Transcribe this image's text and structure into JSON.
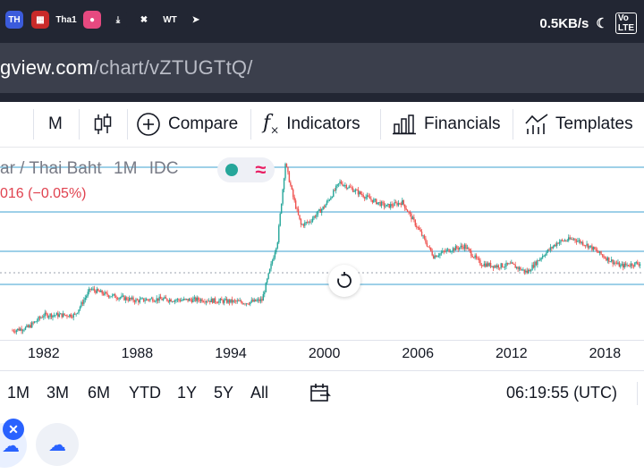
{
  "status_bar": {
    "app_icons": [
      {
        "name": "app-icon-th",
        "text": "TH",
        "color": "#3b5bdb"
      },
      {
        "name": "app-icon-grid",
        "text": "▦",
        "color": "#c92a2a"
      },
      {
        "name": "app-icon-thai",
        "text": "Tha1",
        "color": "#222633"
      },
      {
        "name": "app-icon-pink",
        "text": "●",
        "color": "#e64980"
      },
      {
        "name": "download-icon",
        "text": "⤓",
        "color": "#222633"
      },
      {
        "name": "blocked-icon",
        "text": "✖",
        "color": "#222633"
      },
      {
        "name": "webtoon-icon",
        "text": "WT",
        "color": "#222633"
      },
      {
        "name": "telegram-icon",
        "text": "➤",
        "color": "#222633"
      }
    ],
    "network_speed": "0.5KB/s"
  },
  "url_bar": {
    "host": "gview.com",
    "path": "/chart/vZTUGTtQ/"
  },
  "toolbar": {
    "interval": "M",
    "compare": "Compare",
    "indicators": "Indicators",
    "financials": "Financials",
    "templates": "Templates"
  },
  "legend": {
    "symbol": "ar / Thai Baht",
    "interval": "1M",
    "source": "IDC",
    "change": "016 (−0.05%)"
  },
  "chart_data": {
    "type": "candlestick",
    "x": [
      1980,
      1981,
      1982,
      1983,
      1984,
      1985,
      1986,
      1987,
      1988,
      1989,
      1990,
      1991,
      1992,
      1993,
      1994,
      1995,
      1996,
      1997,
      1997.5,
      1998,
      1998.5,
      1999,
      2000,
      2001,
      2002,
      2003,
      2004,
      2005,
      2006,
      2007,
      2008,
      2009,
      2010,
      2011,
      2012,
      2013,
      2014,
      2015,
      2016,
      2017,
      2018,
      2019,
      2020
    ],
    "close": [
      20.5,
      21.0,
      23.0,
      23.0,
      23.0,
      27.2,
      26.3,
      25.8,
      25.3,
      25.6,
      25.5,
      25.4,
      25.5,
      25.3,
      25.2,
      25.0,
      25.4,
      35.0,
      47.5,
      42.0,
      37.5,
      38.0,
      40.5,
      44.4,
      43.0,
      41.6,
      40.5,
      41.2,
      37.0,
      32.5,
      33.5,
      34.1,
      31.3,
      30.9,
      31.1,
      29.9,
      32.6,
      34.8,
      35.3,
      34.1,
      32.3,
      30.9,
      31.3
    ],
    "xlabels": [
      "1982",
      "1988",
      "1994",
      "2000",
      "2006",
      "2012",
      "2018"
    ],
    "grid": "horizontal lines",
    "ylim": [
      19,
      50
    ]
  },
  "xaxis_labels": [
    "1982",
    "1988",
    "1994",
    "2000",
    "2006",
    "2012",
    "2018"
  ],
  "ranges": [
    "1M",
    "3M",
    "6M",
    "YTD",
    "1Y",
    "5Y",
    "All"
  ],
  "time": "06:19:55 (UTC)",
  "colors": {
    "up": "#26a69a",
    "down": "#ef5350",
    "hline": "#64b5d9",
    "accent": "#2962ff"
  }
}
